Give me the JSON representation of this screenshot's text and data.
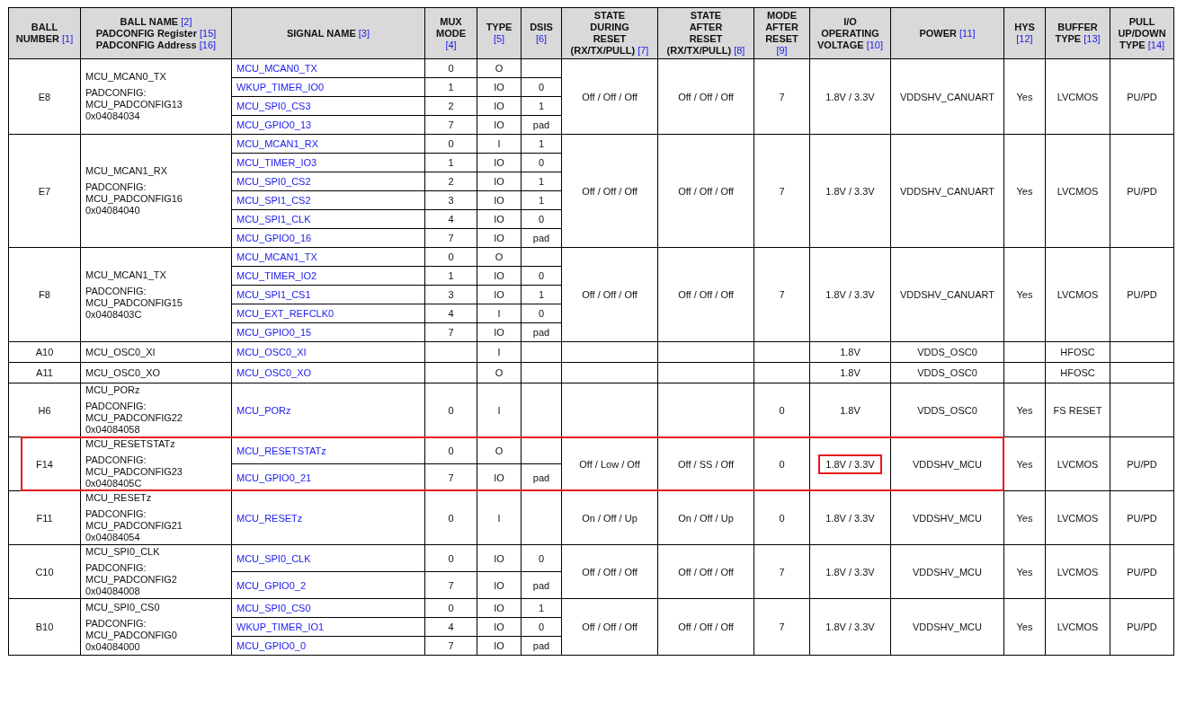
{
  "table": {
    "columns": [
      {
        "lines": [
          {
            "text": "BALL"
          },
          {
            "text": "NUMBER",
            "ref": "[1]"
          }
        ]
      },
      {
        "lines": [
          {
            "text": "BALL NAME",
            "ref": "[2]"
          },
          {
            "text": "PADCONFIG Register",
            "ref": "[15]"
          },
          {
            "text": "PADCONFIG Address",
            "ref": "[16]"
          }
        ]
      },
      {
        "lines": [
          {
            "text": "SIGNAL NAME",
            "ref": "[3]"
          }
        ]
      },
      {
        "lines": [
          {
            "text": "MUX"
          },
          {
            "text": "MODE"
          },
          {
            "ref": "[4]"
          }
        ]
      },
      {
        "lines": [
          {
            "text": "TYPE"
          },
          {
            "ref": "[5]"
          }
        ]
      },
      {
        "lines": [
          {
            "text": "DSIS"
          },
          {
            "ref": "[6]"
          }
        ]
      },
      {
        "lines": [
          {
            "text": "STATE"
          },
          {
            "text": "DURING"
          },
          {
            "text": "RESET"
          },
          {
            "text": "(RX/TX/PULL)",
            "ref": "[7]"
          }
        ]
      },
      {
        "lines": [
          {
            "text": "STATE"
          },
          {
            "text": "AFTER"
          },
          {
            "text": "RESET"
          },
          {
            "text": "(RX/TX/PULL)",
            "ref": "[8]"
          }
        ]
      },
      {
        "lines": [
          {
            "text": "MODE"
          },
          {
            "text": "AFTER"
          },
          {
            "text": "RESET"
          },
          {
            "ref": "[9]"
          }
        ]
      },
      {
        "lines": [
          {
            "text": "I/O"
          },
          {
            "text": "OPERATING"
          },
          {
            "text": "VOLTAGE",
            "ref": "[10]"
          }
        ]
      },
      {
        "lines": [
          {
            "text": "POWER",
            "ref": "[11]"
          }
        ]
      },
      {
        "lines": [
          {
            "text": "HYS"
          },
          {
            "ref": "[12]"
          }
        ]
      },
      {
        "lines": [
          {
            "text": "BUFFER"
          },
          {
            "text": "TYPE",
            "ref": "[13]"
          }
        ]
      },
      {
        "lines": [
          {
            "text": "PULL"
          },
          {
            "text": "UP/DOWN"
          },
          {
            "text": "TYPE",
            "ref": "[14]"
          }
        ]
      }
    ],
    "rows": [
      {
        "ball": "E8",
        "name": "MCU_MCAN0_TX",
        "padconfig_label": "PADCONFIG:",
        "register": "MCU_PADCONFIG13",
        "address": "0x04084034",
        "signals": [
          {
            "name": "MCU_MCAN0_TX",
            "mux": "0",
            "type": "O"
          },
          {
            "name": "WKUP_TIMER_IO0",
            "mux": "1",
            "type": "IO",
            "dsis": "0"
          },
          {
            "name": "MCU_SPI0_CS3",
            "mux": "2",
            "type": "IO",
            "dsis": "1"
          },
          {
            "name": "MCU_GPIO0_13",
            "mux": "7",
            "type": "IO",
            "dsis": "pad"
          }
        ],
        "state_during_reset": "Off / Off / Off",
        "state_after_reset": "Off / Off / Off",
        "mode_after_reset": "7",
        "voltage": "1.8V / 3.3V",
        "power": "VDDSHV_CANUART",
        "hys": "Yes",
        "buffer": "LVCMOS",
        "pull": "PU/PD",
        "highlighted": false,
        "voltage_highlighted": false
      },
      {
        "ball": "E7",
        "name": "MCU_MCAN1_RX",
        "padconfig_label": "PADCONFIG:",
        "register": "MCU_PADCONFIG16",
        "address": "0x04084040",
        "signals": [
          {
            "name": "MCU_MCAN1_RX",
            "mux": "0",
            "type": "I",
            "dsis": "1"
          },
          {
            "name": "MCU_TIMER_IO3",
            "mux": "1",
            "type": "IO",
            "dsis": "0"
          },
          {
            "name": "MCU_SPI0_CS2",
            "mux": "2",
            "type": "IO",
            "dsis": "1"
          },
          {
            "name": "MCU_SPI1_CS2",
            "mux": "3",
            "type": "IO",
            "dsis": "1"
          },
          {
            "name": "MCU_SPI1_CLK",
            "mux": "4",
            "type": "IO",
            "dsis": "0"
          },
          {
            "name": "MCU_GPIO0_16",
            "mux": "7",
            "type": "IO",
            "dsis": "pad"
          }
        ],
        "state_during_reset": "Off / Off / Off",
        "state_after_reset": "Off / Off / Off",
        "mode_after_reset": "7",
        "voltage": "1.8V / 3.3V",
        "power": "VDDSHV_CANUART",
        "hys": "Yes",
        "buffer": "LVCMOS",
        "pull": "PU/PD",
        "highlighted": false,
        "voltage_highlighted": false
      },
      {
        "ball": "F8",
        "name": "MCU_MCAN1_TX",
        "padconfig_label": "PADCONFIG:",
        "register": "MCU_PADCONFIG15",
        "address": "0x0408403C",
        "signals": [
          {
            "name": "MCU_MCAN1_TX",
            "mux": "0",
            "type": "O"
          },
          {
            "name": "MCU_TIMER_IO2",
            "mux": "1",
            "type": "IO",
            "dsis": "0"
          },
          {
            "name": "MCU_SPI1_CS1",
            "mux": "3",
            "type": "IO",
            "dsis": "1"
          },
          {
            "name": "MCU_EXT_REFCLK0",
            "mux": "4",
            "type": "I",
            "dsis": "0"
          },
          {
            "name": "MCU_GPIO0_15",
            "mux": "7",
            "type": "IO",
            "dsis": "pad"
          }
        ],
        "state_during_reset": "Off / Off / Off",
        "state_after_reset": "Off / Off / Off",
        "mode_after_reset": "7",
        "voltage": "1.8V / 3.3V",
        "power": "VDDSHV_CANUART",
        "hys": "Yes",
        "buffer": "LVCMOS",
        "pull": "PU/PD",
        "highlighted": false,
        "voltage_highlighted": false
      },
      {
        "ball": "A10",
        "name": "MCU_OSC0_XI",
        "signals": [
          {
            "name": "MCU_OSC0_XI",
            "type": "I"
          }
        ],
        "voltage": "1.8V",
        "power": "VDDS_OSC0",
        "buffer": "HFOSC",
        "highlighted": false,
        "voltage_highlighted": false
      },
      {
        "ball": "A11",
        "name": "MCU_OSC0_XO",
        "signals": [
          {
            "name": "MCU_OSC0_XO",
            "type": "O"
          }
        ],
        "voltage": "1.8V",
        "power": "VDDS_OSC0",
        "buffer": "HFOSC",
        "highlighted": false,
        "voltage_highlighted": false
      },
      {
        "ball": "H6",
        "name": "MCU_PORz",
        "padconfig_label": "PADCONFIG:",
        "register": "MCU_PADCONFIG22",
        "address": "0x04084058",
        "signals": [
          {
            "name": "MCU_PORz",
            "mux": "0",
            "type": "I"
          }
        ],
        "mode_after_reset": "0",
        "voltage": "1.8V",
        "power": "VDDS_OSC0",
        "hys": "Yes",
        "buffer": "FS RESET",
        "highlighted": false,
        "voltage_highlighted": false
      },
      {
        "ball": "F14",
        "name": "MCU_RESETSTATz",
        "padconfig_label": "PADCONFIG:",
        "register": "MCU_PADCONFIG23",
        "address": "0x0408405C",
        "signals": [
          {
            "name": "MCU_RESETSTATz",
            "mux": "0",
            "type": "O"
          },
          {
            "name": "MCU_GPIO0_21",
            "mux": "7",
            "type": "IO",
            "dsis": "pad"
          }
        ],
        "state_during_reset": "Off / Low / Off",
        "state_after_reset": "Off / SS / Off",
        "mode_after_reset": "0",
        "voltage": "1.8V / 3.3V",
        "power": "VDDSHV_MCU",
        "hys": "Yes",
        "buffer": "LVCMOS",
        "pull": "PU/PD",
        "highlighted": true,
        "voltage_highlighted": true
      },
      {
        "ball": "F11",
        "name": "MCU_RESETz",
        "padconfig_label": "PADCONFIG:",
        "register": "MCU_PADCONFIG21",
        "address": "0x04084054",
        "signals": [
          {
            "name": "MCU_RESETz",
            "mux": "0",
            "type": "I"
          }
        ],
        "state_during_reset": "On / Off / Up",
        "state_after_reset": "On / Off / Up",
        "mode_after_reset": "0",
        "voltage": "1.8V / 3.3V",
        "power": "VDDSHV_MCU",
        "hys": "Yes",
        "buffer": "LVCMOS",
        "pull": "PU/PD",
        "highlighted": false,
        "voltage_highlighted": false
      },
      {
        "ball": "C10",
        "name": "MCU_SPI0_CLK",
        "padconfig_label": "PADCONFIG:",
        "register": "MCU_PADCONFIG2",
        "address": "0x04084008",
        "signals": [
          {
            "name": "MCU_SPI0_CLK",
            "mux": "0",
            "type": "IO",
            "dsis": "0"
          },
          {
            "name": "MCU_GPIO0_2",
            "mux": "7",
            "type": "IO",
            "dsis": "pad"
          }
        ],
        "state_during_reset": "Off / Off / Off",
        "state_after_reset": "Off / Off / Off",
        "mode_after_reset": "7",
        "voltage": "1.8V / 3.3V",
        "power": "VDDSHV_MCU",
        "hys": "Yes",
        "buffer": "LVCMOS",
        "pull": "PU/PD",
        "highlighted": false,
        "voltage_highlighted": false
      },
      {
        "ball": "B10",
        "name": "MCU_SPI0_CS0",
        "padconfig_label": "PADCONFIG:",
        "register": "MCU_PADCONFIG0",
        "address": "0x04084000",
        "signals": [
          {
            "name": "MCU_SPI0_CS0",
            "mux": "0",
            "type": "IO",
            "dsis": "1"
          },
          {
            "name": "WKUP_TIMER_IO1",
            "mux": "4",
            "type": "IO",
            "dsis": "0"
          },
          {
            "name": "MCU_GPIO0_0",
            "mux": "7",
            "type": "IO",
            "dsis": "pad"
          }
        ],
        "state_during_reset": "Off / Off / Off",
        "state_after_reset": "Off / Off / Off",
        "mode_after_reset": "7",
        "voltage": "1.8V / 3.3V",
        "power": "VDDSHV_MCU",
        "hys": "Yes",
        "buffer": "LVCMOS",
        "pull": "PU/PD",
        "highlighted": false,
        "voltage_highlighted": false
      }
    ]
  }
}
